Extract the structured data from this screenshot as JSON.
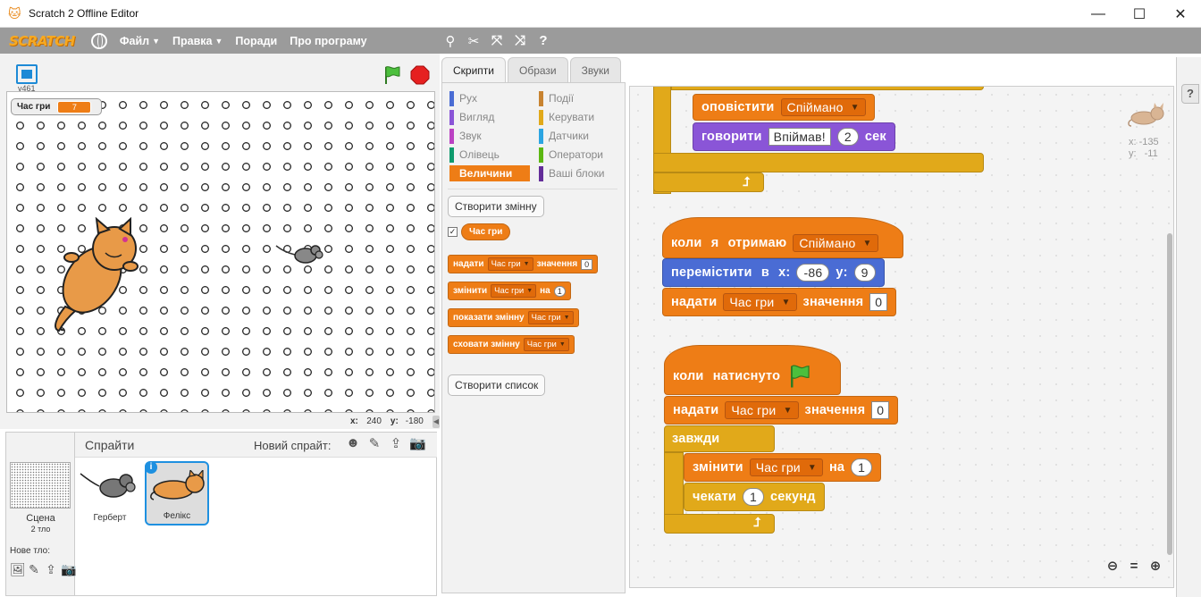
{
  "window": {
    "title": "Scratch 2 Offline Editor",
    "controls": [
      "minimize",
      "maximize",
      "close"
    ]
  },
  "menubar": {
    "logo": "SCRATCH",
    "items": [
      {
        "label": "Файл",
        "has_caret": true
      },
      {
        "label": "Правка",
        "has_caret": true
      },
      {
        "label": "Поради",
        "has_caret": false
      },
      {
        "label": "Про програму",
        "has_caret": false
      }
    ],
    "tools": [
      "duplicate-icon",
      "cut-icon",
      "grow-icon",
      "shrink-icon",
      "help-icon"
    ]
  },
  "stage": {
    "version": "v461",
    "monitor": {
      "label": "Час гри",
      "value": "7"
    },
    "coords": {
      "x_label": "x:",
      "x": "240",
      "y_label": "y:",
      "y": "-180"
    }
  },
  "sprites_pane": {
    "title": "Спрайти",
    "new_sprite_label": "Новий спрайт:",
    "scene_label": "Сцена",
    "scene_count": "2 тло",
    "new_backdrop_label": "Нове тло:",
    "sprites": [
      {
        "name": "Герберт",
        "selected": false
      },
      {
        "name": "Фелікс",
        "selected": true
      }
    ]
  },
  "tabs": [
    {
      "label": "Скрипти",
      "active": true
    },
    {
      "label": "Образи",
      "active": false
    },
    {
      "label": "Звуки",
      "active": false
    }
  ],
  "palette": {
    "categories": [
      {
        "label": "Рух",
        "color": "#4a6cd4",
        "active": false
      },
      {
        "label": "Події",
        "color": "#c88330",
        "active": false
      },
      {
        "label": "Вигляд",
        "color": "#8a55d7",
        "active": false
      },
      {
        "label": "Керувати",
        "color": "#e1a91a",
        "active": false
      },
      {
        "label": "Звук",
        "color": "#bb42c3",
        "active": false
      },
      {
        "label": "Датчики",
        "color": "#2ca5e2",
        "active": false
      },
      {
        "label": "Олівець",
        "color": "#0e9a6c",
        "active": false
      },
      {
        "label": "Оператори",
        "color": "#5cb712",
        "active": false
      },
      {
        "label": "Величини",
        "color": "#ee7d16",
        "active": true
      },
      {
        "label": "Ваші блоки",
        "color": "#632d99",
        "active": false
      }
    ],
    "make_variable": "Створити змінну",
    "variable_reporter": "Час гри",
    "variable_checked": true,
    "blocks": {
      "set": {
        "pre": "надати",
        "var": "Час гри",
        "post": "значення",
        "value": "0"
      },
      "change": {
        "pre": "змінити",
        "var": "Час гри",
        "post": "на",
        "value": "1"
      },
      "show": {
        "pre": "показати змінну",
        "var": "Час гри"
      },
      "hide": {
        "pre": "сховати змінну",
        "var": "Час гри"
      }
    },
    "make_list": "Створити список"
  },
  "scripts": {
    "broadcast": {
      "label": "оповістити",
      "value": "Спіймано"
    },
    "say": {
      "label": "говорити",
      "text": "Впіймав!",
      "secs": "2",
      "unit": "сек"
    },
    "script2": {
      "hat": {
        "label": "коли я отримаю",
        "value": "Спіймано"
      },
      "goto": {
        "label": "перемістити в x:",
        "x": "-86",
        "y_label": "y:",
        "y": "9"
      },
      "set": {
        "pre": "надати",
        "var": "Час гри",
        "post": "значення",
        "value": "0"
      }
    },
    "script3": {
      "hat": {
        "label": "коли натиснуто"
      },
      "set": {
        "pre": "надати",
        "var": "Час гри",
        "post": "значення",
        "value": "0"
      },
      "forever": "завжди",
      "change": {
        "pre": "змінити",
        "var": "Час гри",
        "post": "на",
        "value": "1"
      },
      "wait": {
        "pre": "чекати",
        "value": "1",
        "post": "секунд"
      }
    },
    "sprite_info": {
      "x_label": "x:",
      "x": "-135",
      "y_label": "y:",
      "y": "-11"
    }
  },
  "zoom": [
    "zoom-out-icon",
    "zoom-reset-icon",
    "zoom-in-icon"
  ],
  "help_button": "?"
}
